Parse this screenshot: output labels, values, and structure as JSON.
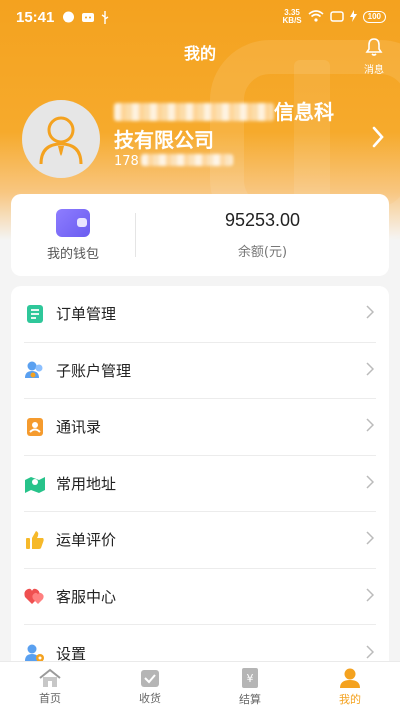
{
  "status": {
    "time": "15:41",
    "speed": "3.35\nKB/S",
    "battery": "100"
  },
  "header": {
    "title": "我的",
    "message_label": "消息"
  },
  "profile": {
    "company_visible": "信息科",
    "company_line2": "技有限公司",
    "phone_prefix": "178"
  },
  "wallet": {
    "label": "我的钱包",
    "amount": "95253.00",
    "amount_caption": "余额(元)"
  },
  "menu": [
    {
      "label": "订单管理",
      "icon": "order-doc-icon"
    },
    {
      "label": "子账户管理",
      "icon": "sub-account-icon"
    },
    {
      "label": "通讯录",
      "icon": "contacts-icon"
    },
    {
      "label": "常用地址",
      "icon": "map-pin-icon"
    },
    {
      "label": "运单评价",
      "icon": "thumb-up-icon"
    },
    {
      "label": "客服中心",
      "icon": "heart-service-icon"
    },
    {
      "label": "设置",
      "icon": "settings-user-icon"
    }
  ],
  "tabs": [
    {
      "label": "首页",
      "icon": "home-icon"
    },
    {
      "label": "收货",
      "icon": "receive-icon"
    },
    {
      "label": "结算",
      "icon": "settle-icon"
    },
    {
      "label": "我的",
      "icon": "profile-icon"
    }
  ],
  "colors": {
    "accent": "#f4a21f",
    "menu_text": "#222222"
  }
}
